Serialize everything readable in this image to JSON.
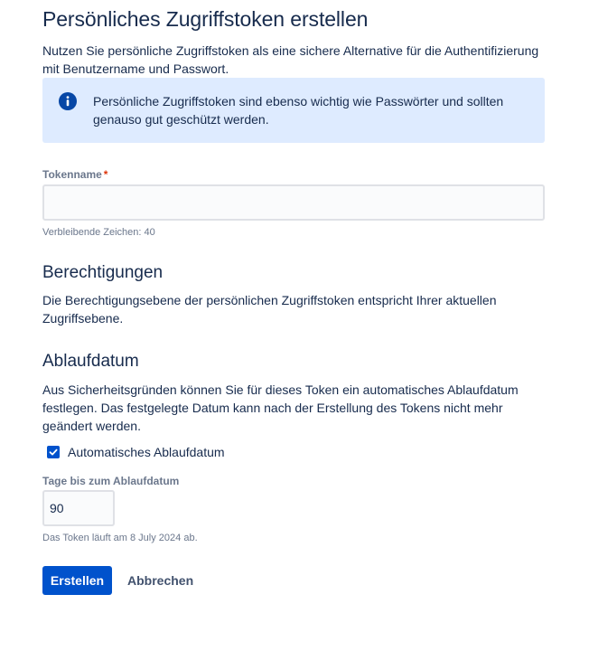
{
  "page": {
    "title": "Persönliches Zugriffstoken erstellen",
    "intro": "Nutzen Sie persönliche Zugriffstoken als eine sichere Alternative für die Authentifizierung mit Benutzername und Passwort."
  },
  "info": {
    "icon": "info-icon",
    "text": "Persönliche Zugriffstoken sind ebenso wichtig wie Passwörter und sollten genauso gut geschützt werden."
  },
  "token_name": {
    "label": "Tokenname",
    "required_marker": "*",
    "value": "",
    "helper": "Verbleibende Zeichen: 40"
  },
  "permissions": {
    "heading": "Berechtigungen",
    "text": "Die Berechtigungsebene der persönlichen Zugriffstoken entspricht Ihrer aktuellen Zugriffsebene."
  },
  "expiry": {
    "heading": "Ablaufdatum",
    "text": "Aus Sicherheitsgründen können Sie für dieses Token ein automatisches Ablaufdatum festlegen. Das festgelegte Datum kann nach der Erstellung des Tokens nicht mehr geändert werden.",
    "checkbox_label": "Automatisches Ablaufdatum",
    "checkbox_checked": true,
    "days_label": "Tage bis zum Ablaufdatum",
    "days_value": "90",
    "helper": "Das Token läuft am 8 July 2024 ab."
  },
  "actions": {
    "create_label": "Erstellen",
    "cancel_label": "Abbrechen"
  },
  "colors": {
    "primary": "#0052cc",
    "info_background": "#deebff",
    "text": "#172b4d",
    "subtle_text": "#6b778c",
    "required": "#de350b"
  }
}
